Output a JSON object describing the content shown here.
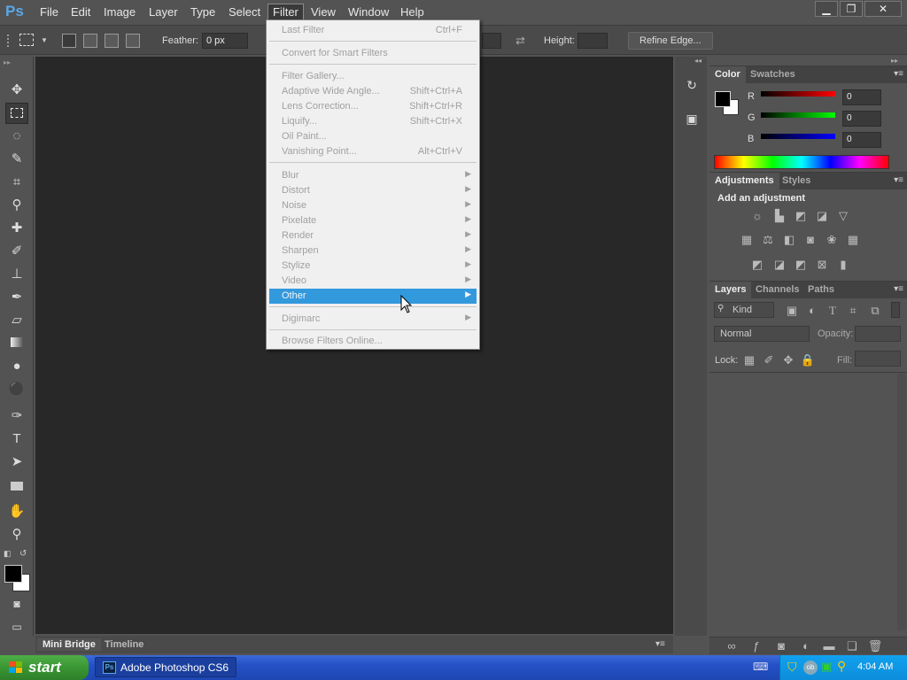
{
  "app": {
    "logo": "Ps"
  },
  "menubar": {
    "items": [
      "File",
      "Edit",
      "Image",
      "Layer",
      "Type",
      "Select",
      "Filter",
      "View",
      "Window",
      "Help"
    ],
    "active": "Filter"
  },
  "window_controls": {
    "minimize": "▁",
    "restore": "❐",
    "close": "✕"
  },
  "options_bar": {
    "feather_label": "Feather:",
    "feather_value": "0 px",
    "height_label": "Height:",
    "refine_edge_label": "Refine Edge..."
  },
  "filter_menu": {
    "items": [
      {
        "label": "Last Filter",
        "shortcut": "Ctrl+F"
      },
      {
        "label": "Convert for Smart Filters",
        "shortcut": ""
      },
      {
        "label": "Filter Gallery...",
        "shortcut": ""
      },
      {
        "label": "Adaptive Wide Angle...",
        "shortcut": "Shift+Ctrl+A"
      },
      {
        "label": "Lens Correction...",
        "shortcut": "Shift+Ctrl+R"
      },
      {
        "label": "Liquify...",
        "shortcut": "Shift+Ctrl+X"
      },
      {
        "label": "Oil Paint...",
        "shortcut": ""
      },
      {
        "label": "Vanishing Point...",
        "shortcut": "Alt+Ctrl+V"
      },
      {
        "label": "Blur",
        "shortcut": ""
      },
      {
        "label": "Distort",
        "shortcut": ""
      },
      {
        "label": "Noise",
        "shortcut": ""
      },
      {
        "label": "Pixelate",
        "shortcut": ""
      },
      {
        "label": "Render",
        "shortcut": ""
      },
      {
        "label": "Sharpen",
        "shortcut": ""
      },
      {
        "label": "Stylize",
        "shortcut": ""
      },
      {
        "label": "Video",
        "shortcut": ""
      },
      {
        "label": "Other",
        "shortcut": ""
      },
      {
        "label": "Digimarc",
        "shortcut": ""
      },
      {
        "label": "Browse Filters Online...",
        "shortcut": ""
      }
    ],
    "highlighted": "Other",
    "highlight_color": "#3399dd"
  },
  "bottom_tabs": {
    "mini_bridge": "Mini Bridge",
    "timeline": "Timeline"
  },
  "color_panel": {
    "tabs": [
      "Color",
      "Swatches"
    ],
    "r_label": "R",
    "g_label": "G",
    "b_label": "B",
    "r_value": "0",
    "g_value": "0",
    "b_value": "0"
  },
  "adjustments_panel": {
    "tabs": [
      "Adjustments",
      "Styles"
    ],
    "heading": "Add an adjustment"
  },
  "layers_panel": {
    "tabs": [
      "Layers",
      "Channels",
      "Paths"
    ],
    "kind_label": "Kind",
    "blend_mode": "Normal",
    "opacity_label": "Opacity:",
    "lock_label": "Lock:",
    "fill_label": "Fill:"
  },
  "taskbar": {
    "start_label": "start",
    "task_item": "Adobe Photoshop CS6",
    "clock": "4:04 AM"
  }
}
